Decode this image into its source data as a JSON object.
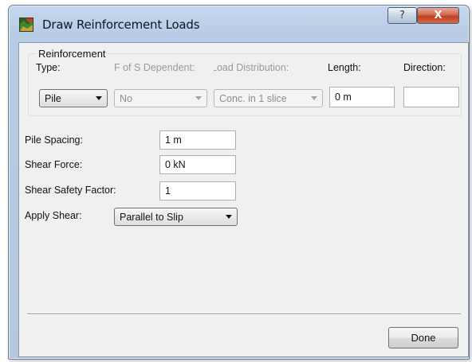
{
  "window": {
    "title": "Draw Reinforcement Loads",
    "help_label": "?",
    "close_label": "X"
  },
  "reinforcement": {
    "group_title": "Reinforcement",
    "type_label": "Type:",
    "type_value": "Pile",
    "fos_label": "F of S Dependent:",
    "fos_value": "No",
    "load_label": "Load Distribution:",
    "load_value": "Conc. in 1 slice",
    "length_label": "Length:",
    "length_value": "0 m",
    "direction_label": "Direction:",
    "direction_value": ""
  },
  "fields": {
    "pile_spacing_label": "Pile Spacing:",
    "pile_spacing_value": "1 m",
    "shear_force_label": "Shear Force:",
    "shear_force_value": "0 kN",
    "shear_safety_label": "Shear Safety Factor:",
    "shear_safety_value": "1",
    "apply_shear_label": "Apply Shear:",
    "apply_shear_value": "Parallel to Slip"
  },
  "footer": {
    "done_label": "Done"
  }
}
